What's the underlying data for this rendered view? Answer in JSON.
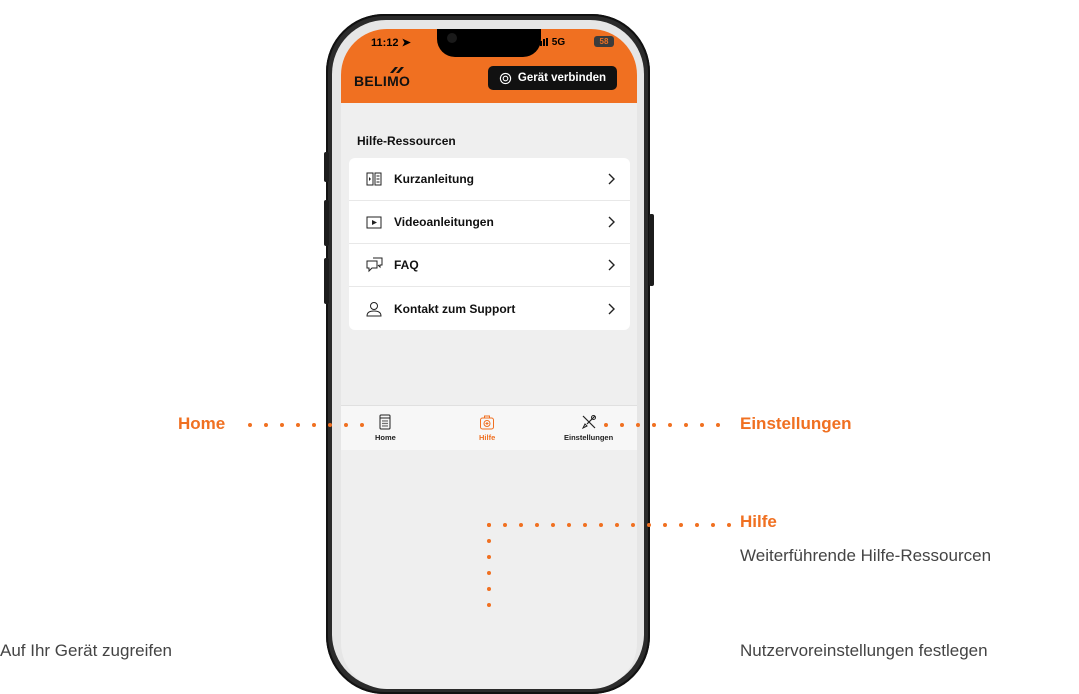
{
  "status_bar": {
    "time": "11:12",
    "signal": "5G",
    "battery": "58"
  },
  "header": {
    "logo": "BELIMO",
    "connect_button": "Gerät verbinden"
  },
  "section_title": "Hilfe-Ressourcen",
  "help_items": [
    {
      "label": "Kurzanleitung",
      "icon": "book-icon"
    },
    {
      "label": "Videoanleitungen",
      "icon": "video-icon"
    },
    {
      "label": "FAQ",
      "icon": "faq-icon"
    },
    {
      "label": "Kontakt zum Support",
      "icon": "person-icon"
    }
  ],
  "tabs": [
    {
      "label": "Home",
      "icon": "device-icon"
    },
    {
      "label": "Hilfe",
      "icon": "help-kit-icon",
      "active": true
    },
    {
      "label": "Einstellungen",
      "icon": "tools-icon"
    }
  ],
  "annotations": {
    "hilfe": {
      "title": "Hilfe",
      "desc": "Weiterführende Hilfe-Ressourcen"
    },
    "home": {
      "title": "Home",
      "desc": "Auf Ihr Gerät zugreifen"
    },
    "einstellungen": {
      "title": "Einstellungen",
      "desc": "Nutzervoreinstellungen festlegen"
    }
  },
  "colors": {
    "accent": "#f07021",
    "dark": "#111111",
    "background": "#efefef"
  }
}
